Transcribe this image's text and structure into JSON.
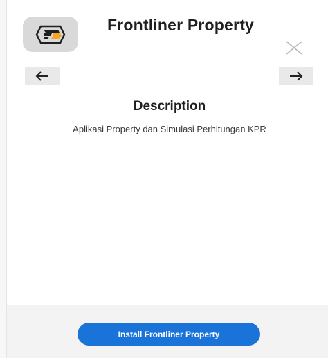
{
  "app": {
    "title": "Frontliner Property",
    "icon": "frontliner-logo-icon"
  },
  "description": {
    "heading": "Description",
    "text": "Aplikasi Property dan Simulasi Perhitungan KPR"
  },
  "footer": {
    "install_label": "Install Frontliner Property"
  },
  "colors": {
    "install_button": "#1a73d9",
    "icon_background": "#d9d9d9",
    "logo_orange": "#f5a623"
  }
}
